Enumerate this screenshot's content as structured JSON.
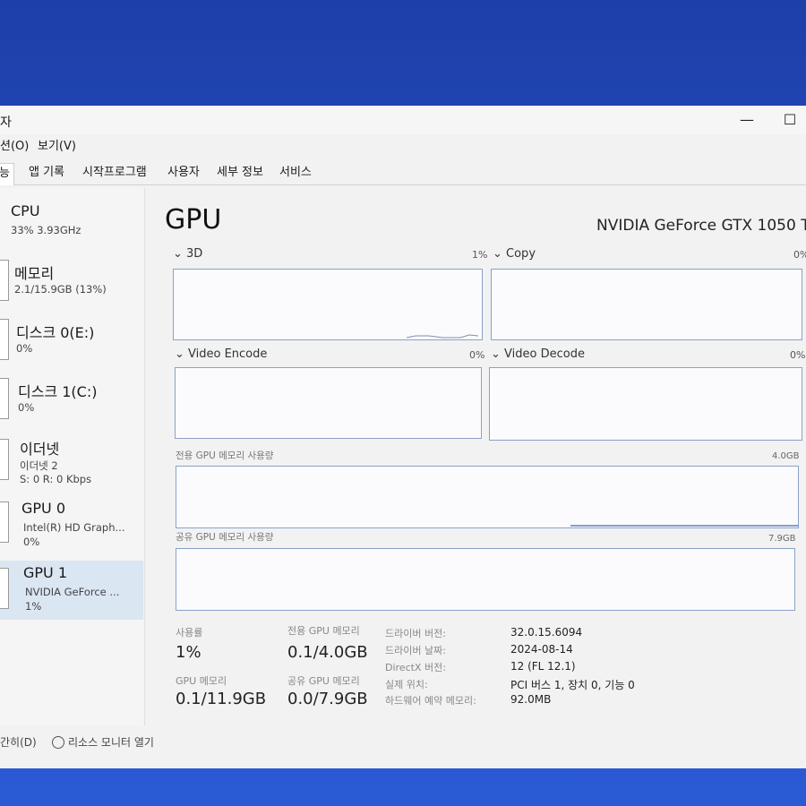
{
  "window": {
    "title_fragment": "자",
    "minimize_glyph": "—",
    "maximize_glyph": "☐"
  },
  "menu": [
    "션(O)",
    "보기(V)"
  ],
  "tabs": [
    {
      "label": "능",
      "active": true
    },
    {
      "label": "앱 기록"
    },
    {
      "label": "시작프로그램"
    },
    {
      "label": "사용자"
    },
    {
      "label": "세부 정보"
    },
    {
      "label": "서비스"
    }
  ],
  "sidebar": {
    "items": [
      {
        "title": "CPU",
        "line1": "33% 3.93GHz",
        "line2": ""
      },
      {
        "title": "메모리",
        "line1": "2.1/15.9GB (13%)",
        "line2": ""
      },
      {
        "title": "디스크 0(E:)",
        "line1": "0%",
        "line2": ""
      },
      {
        "title": "디스크 1(C:)",
        "line1": "0%",
        "line2": ""
      },
      {
        "title": "이더넷",
        "line1": "이더넷 2",
        "line2": "S: 0 R: 0 Kbps"
      },
      {
        "title": "GPU 0",
        "line1": "Intel(R) HD Graph...",
        "line2": "0%"
      },
      {
        "title": "GPU 1",
        "line1": "NVIDIA GeForce ...",
        "line2": "1%"
      }
    ]
  },
  "main": {
    "title": "GPU",
    "gpu_name": "NVIDIA GeForce GTX 1050 T",
    "engines": [
      {
        "name": "3D",
        "percent": "1%"
      },
      {
        "name": "Copy",
        "percent": "0%"
      },
      {
        "name": "Video Encode",
        "percent": "0%"
      },
      {
        "name": "Video Decode",
        "percent": "0%"
      }
    ],
    "dedicated_memory": {
      "label": "전용 GPU 메모리 사용량",
      "max": "4.0GB"
    },
    "shared_memory": {
      "label": "공유 GPU 메모리 사용량",
      "max": "7.9GB"
    }
  },
  "stats": {
    "utilization": {
      "label": "사용률",
      "value": "1%"
    },
    "dedicated": {
      "label": "전용 GPU 메모리",
      "value": "0.1/4.0GB"
    },
    "gpu_memory": {
      "label": "GPU 메모리",
      "value": "0.1/11.9GB"
    },
    "shared": {
      "label": "공유 GPU 메모리",
      "value": "0.0/7.9GB"
    }
  },
  "info": [
    {
      "label": "드라이버 버전:",
      "value": "32.0.15.6094"
    },
    {
      "label": "드라이버 날짜:",
      "value": "2024-08-14"
    },
    {
      "label": "DirectX 버전:",
      "value": "12 (FL 12.1)"
    },
    {
      "label": "실제 위치:",
      "value": "PCI 버스 1, 장치 0, 기능 0"
    },
    {
      "label": "하드웨어 예약 메모리:",
      "value": "92.0MB"
    }
  ],
  "footer": {
    "fewer_details": "간히(D)",
    "resource_monitor": "리소스 모니터 열기"
  }
}
